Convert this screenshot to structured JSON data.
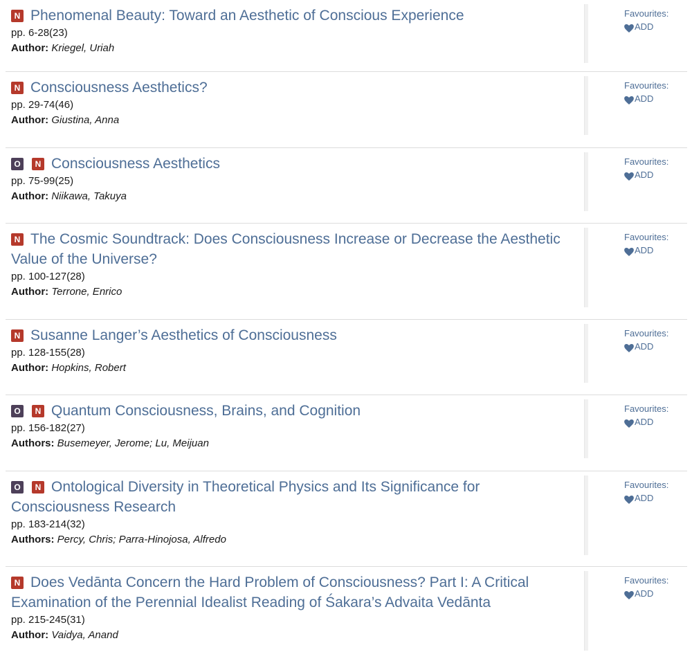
{
  "favourites_label": "Favourites:",
  "add_label": "ADD",
  "badges": {
    "n": "N",
    "o": "O"
  },
  "colors": {
    "link": "#4e6e96",
    "badge_n": "#b5392b",
    "badge_o": "#4d4059"
  },
  "articles": [
    {
      "title": "Phenomenal Beauty: Toward an Aesthetic of Conscious Experience",
      "pages": "pp. 6-28(23)",
      "author_label": "Author:",
      "authors": "Kriegel, Uriah",
      "badges": [
        "n"
      ]
    },
    {
      "title": "Consciousness Aesthetics?",
      "pages": "pp. 29-74(46)",
      "author_label": "Author:",
      "authors": "Giustina, Anna",
      "badges": [
        "n"
      ]
    },
    {
      "title": "Consciousness Aesthetics",
      "pages": "pp. 75-99(25)",
      "author_label": "Author:",
      "authors": "Niikawa, Takuya",
      "badges": [
        "o",
        "n"
      ]
    },
    {
      "title": "The Cosmic Soundtrack: Does Consciousness Increase or Decrease the Aesthetic Value of the Universe?",
      "pages": "pp. 100-127(28)",
      "author_label": "Author:",
      "authors": "Terrone, Enrico",
      "badges": [
        "n"
      ]
    },
    {
      "title": "Susanne Langer’s Aesthetics of Consciousness",
      "pages": "pp. 128-155(28)",
      "author_label": "Author:",
      "authors": "Hopkins, Robert",
      "badges": [
        "n"
      ]
    },
    {
      "title": "Quantum Consciousness, Brains, and Cognition",
      "pages": "pp. 156-182(27)",
      "author_label": "Authors:",
      "authors": "Busemeyer, Jerome; Lu, Meijuan",
      "badges": [
        "o",
        "n"
      ]
    },
    {
      "title": "Ontological Diversity in Theoretical Physics and Its Significance for Consciousness Research",
      "pages": "pp. 183-214(32)",
      "author_label": "Authors:",
      "authors": "Percy, Chris; Parra-Hinojosa, Alfredo",
      "badges": [
        "o",
        "n"
      ]
    },
    {
      "title": "Does Vedānta Concern the Hard Problem of Consciousness? Part I: A Critical Examination of the Perennial Idealist Reading of Śakara’s Advaita Vedānta",
      "pages": "pp. 215-245(31)",
      "author_label": "Author:",
      "authors": "Vaidya, Anand",
      "badges": [
        "n"
      ]
    }
  ]
}
